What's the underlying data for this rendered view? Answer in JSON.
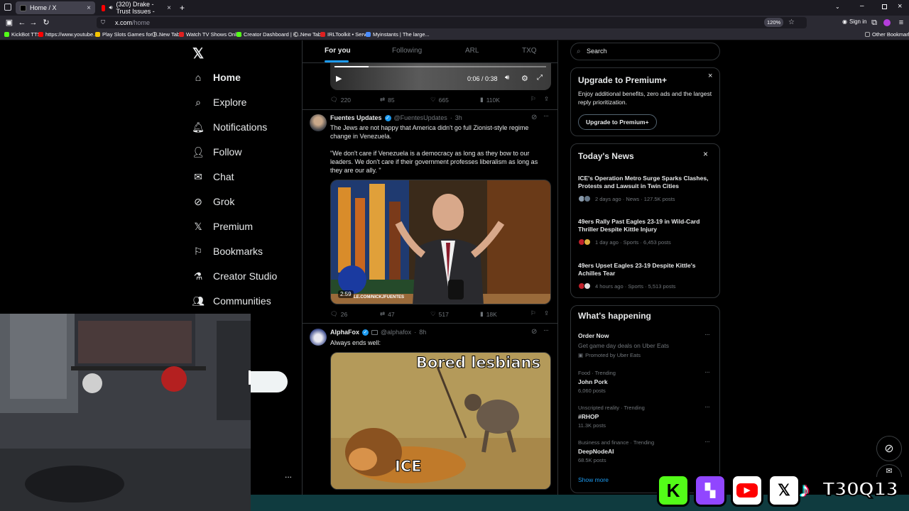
{
  "browser": {
    "tabs": [
      {
        "label": "Home / X",
        "active": true
      },
      {
        "label": "(320) Drake - Trust Issues -",
        "active": false
      }
    ],
    "url_host": "x.com",
    "url_path": "/home",
    "zoom": "120%",
    "sign_in": "Sign in",
    "bookmarks": [
      "KickBot TTS",
      "https://www.youtube...",
      "Play Slots Games for F...",
      "New Tab",
      "Watch TV Shows Onli...",
      "Creator Dashboard | K...",
      "New Tab",
      "IRLToolkit • Server",
      "Myinstants | The large..."
    ],
    "other_bookmarks": "Other Bookmarks"
  },
  "sidebar": {
    "items": [
      {
        "label": "Home",
        "icon": "home-icon"
      },
      {
        "label": "Explore",
        "icon": "search-icon"
      },
      {
        "label": "Notifications",
        "icon": "bell-icon"
      },
      {
        "label": "Follow",
        "icon": "person-add-icon"
      },
      {
        "label": "Chat",
        "icon": "mail-icon"
      },
      {
        "label": "Grok",
        "icon": "grok-icon"
      },
      {
        "label": "Premium",
        "icon": "x-icon"
      },
      {
        "label": "Bookmarks",
        "icon": "bookmark-icon"
      },
      {
        "label": "Creator Studio",
        "icon": "flask-icon"
      },
      {
        "label": "Communities",
        "icon": "people-icon"
      }
    ],
    "more": "..."
  },
  "feed": {
    "tabs": [
      "For you",
      "Following",
      "ARL",
      "TXQ"
    ],
    "video_time": "0:06 / 0:38",
    "progress": 0.16,
    "tweet0_stats": {
      "replies": "220",
      "reposts": "85",
      "likes": "665",
      "views": "110K"
    },
    "tweet1": {
      "name": "Fuentes Updates",
      "handle": "@FuentesUpdates",
      "time": "3h",
      "text": "The Jews are not happy that America didn't go full Zionist-style regime change in Venezuela.\n\n\"We don't care if Venezuela is a democracy as long as they bow to our leaders. We don't care if their government professes liberalism as long as they are our ally. \"",
      "video_duration": "2:59",
      "video_watermark": "LE.COM/NICKJFUENTES",
      "stats": {
        "replies": "26",
        "reposts": "47",
        "likes": "517",
        "views": "18K"
      }
    },
    "tweet2": {
      "name": "AlphaFox",
      "handle": "@alphafox",
      "time": "8h",
      "text": "Always ends well:",
      "meme_top": "Bored lesbians",
      "meme_bottom": "ICE"
    }
  },
  "right": {
    "search_placeholder": "Search",
    "premium": {
      "title": "Upgrade to Premium+",
      "body": "Enjoy additional benefits, zero ads and the largest reply prioritization.",
      "button": "Upgrade to Premium+"
    },
    "news": {
      "title": "Today's News",
      "items": [
        {
          "title": "ICE's Operation Metro Surge Sparks Clashes, Protests and Lawsuit in Twin Cities",
          "meta": "2 days ago · News · 127.5K posts"
        },
        {
          "title": "49ers Rally Past Eagles 23-19 in Wild-Card Thriller Despite Kittle Injury",
          "meta": "1 day ago · Sports · 6,453 posts"
        },
        {
          "title": "49ers Upset Eagles 23-19 Despite Kittle's Achilles Tear",
          "meta": "4 hours ago · Sports · 5,513 posts"
        }
      ]
    },
    "happening": {
      "title": "What's happening",
      "promo": {
        "title": "Order Now",
        "sub": "Get game day deals on Uber Eats",
        "promoted": "Promoted by Uber Eats"
      },
      "trends": [
        {
          "context": "Food · Trending",
          "name": "John Pork",
          "posts": "6,060 posts"
        },
        {
          "context": "Unscripted reality · Trending",
          "name": "#RHOP",
          "posts": "11.3K posts"
        },
        {
          "context": "Business and finance · Trending",
          "name": "DeepNodeAI",
          "posts": "68.5K posts"
        }
      ],
      "show_more": "Show more"
    }
  },
  "overlay": {
    "brand": "T30Q13",
    "colors": {
      "kick": "#53fc18",
      "twitch": "#9146ff",
      "youtube": "#ff0000",
      "x": "#000000",
      "tiktok": "#000000",
      "accent": "#1d9bf0"
    }
  }
}
